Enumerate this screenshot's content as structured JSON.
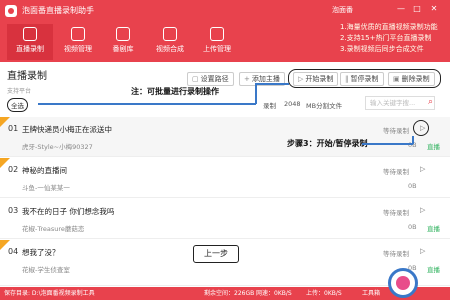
{
  "app": {
    "title": "泡面番直播录制助手",
    "user": "泡面番",
    "win_min": "—",
    "win_max": "□",
    "win_close": "✕"
  },
  "nav": [
    {
      "label": "直播录制"
    },
    {
      "label": "视频管理"
    },
    {
      "label": "番剧库"
    },
    {
      "label": "视频合成"
    },
    {
      "label": "上传管理"
    }
  ],
  "tips": [
    "1.海量优质的直播视频录制功能",
    "2.支持15+热门平台直播录制",
    "3.录制视频后同步合成文件"
  ],
  "section": {
    "title": "直播录制",
    "support": "支持平台"
  },
  "toolbar": {
    "settings": "设置路径",
    "add": "添加主播",
    "start": "开始录制",
    "pause": "暂停录制",
    "delete": "删除录制"
  },
  "filter": {
    "select_all": "全选",
    "record_label": "录制",
    "size_value": "2048",
    "size_unit": "MB分割文件",
    "search_placeholder": "输入关键字搜..."
  },
  "annotations": {
    "batch_note": "注：可批量进行录制操作",
    "step3_note": "步骤3：开始/暂停录制",
    "prev": "上一步"
  },
  "rows": [
    {
      "num": "01",
      "title": "王牌快递员小梅正在派送中",
      "host": "虎牙-Style~小梅90327",
      "status": "等待录制",
      "size": "0B",
      "live": "直播"
    },
    {
      "num": "02",
      "title": "神秘的直播间",
      "host": "斗鱼-一仙某某一",
      "status": "等待录制",
      "size": "0B",
      "live": ""
    },
    {
      "num": "03",
      "title": "我不在的日子 你们想念我吗",
      "host": "花椒-Treasure蘑菇恋",
      "status": "等待录制",
      "size": "0B",
      "live": "直播"
    },
    {
      "num": "04",
      "title": "想我了没？",
      "host": "花椒-学生侦查室",
      "status": "等待录制",
      "size": "0B",
      "live": "直播"
    }
  ],
  "status_bar": {
    "path": "保存目录: D:\\泡面番视频录制工具",
    "disk": "剩余空间：226GB",
    "speed": "网速：0KB/S",
    "up": "上传：0KB/S",
    "tool": "工具箱"
  },
  "colors": {
    "brand": "#e8424d",
    "live": "#2fb25e",
    "annotation_arrow": "#3a78c8"
  }
}
